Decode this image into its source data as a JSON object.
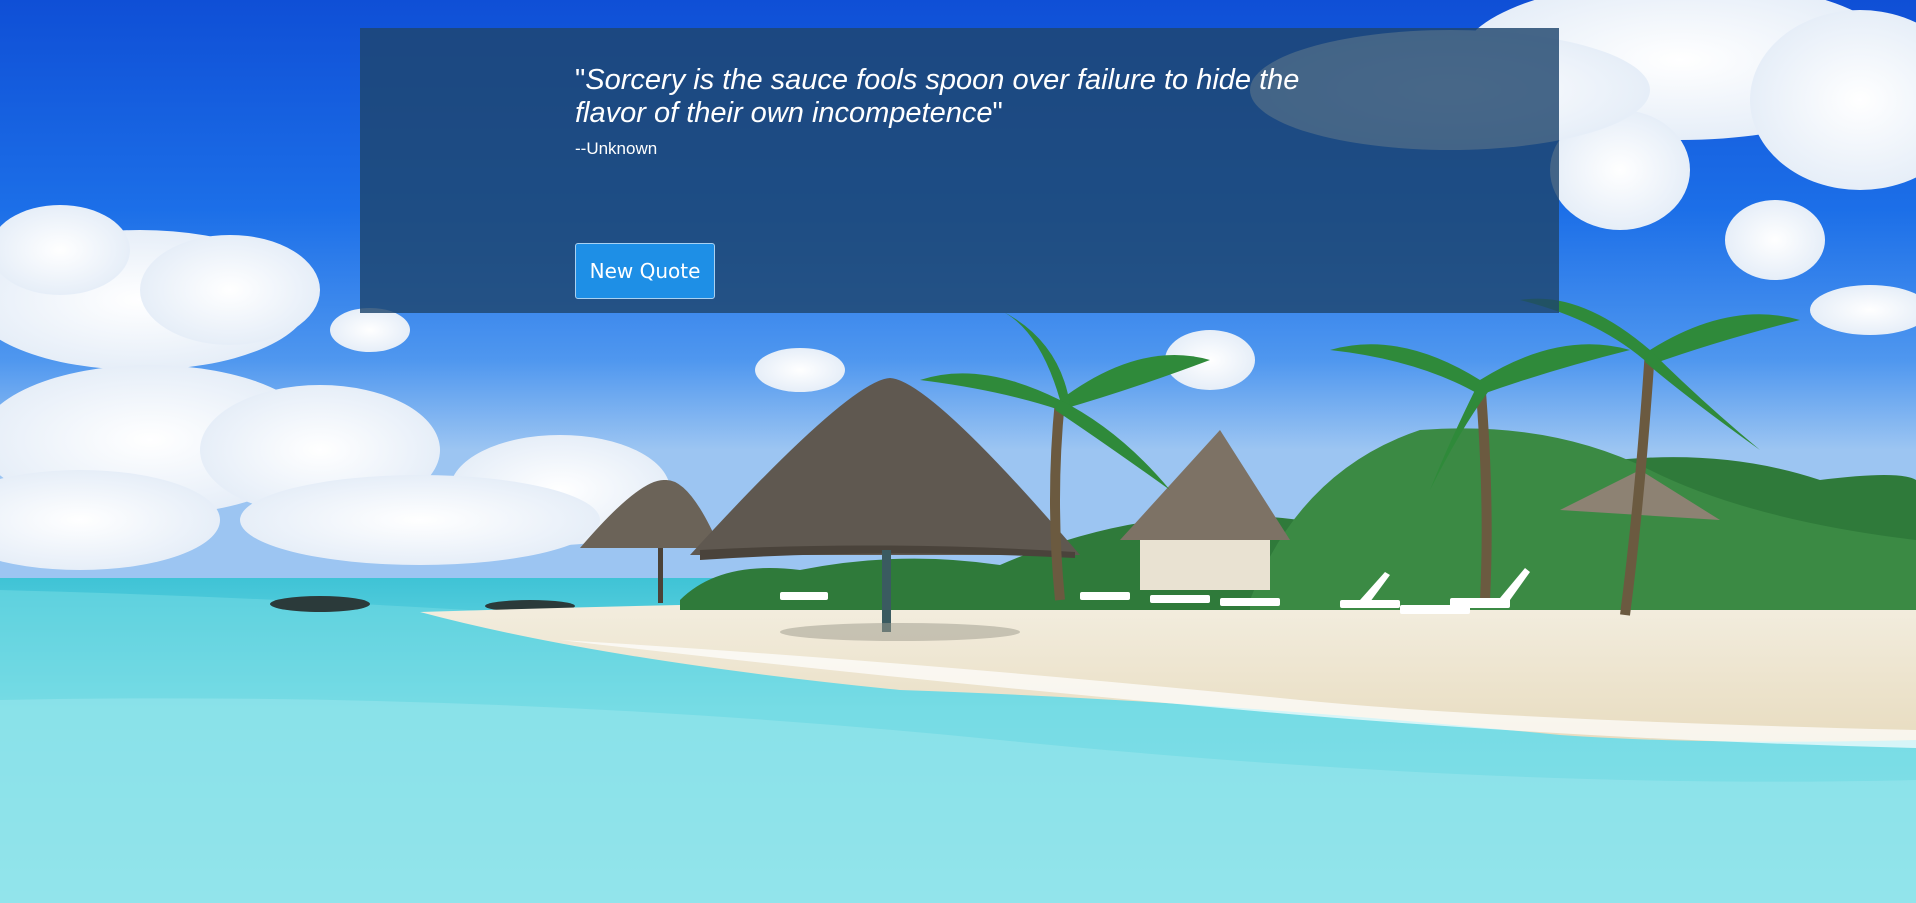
{
  "quote": {
    "open_mark": "\"",
    "text": "Sorcery is the sauce fools spoon over failure to hide the flavor of their own incompetence",
    "close_mark": "\"",
    "author": "--Unknown"
  },
  "controls": {
    "new_quote_label": "New Quote"
  },
  "colors": {
    "overlay": "#1e466e",
    "button": "#1e8fe6",
    "text": "#ffffff"
  }
}
